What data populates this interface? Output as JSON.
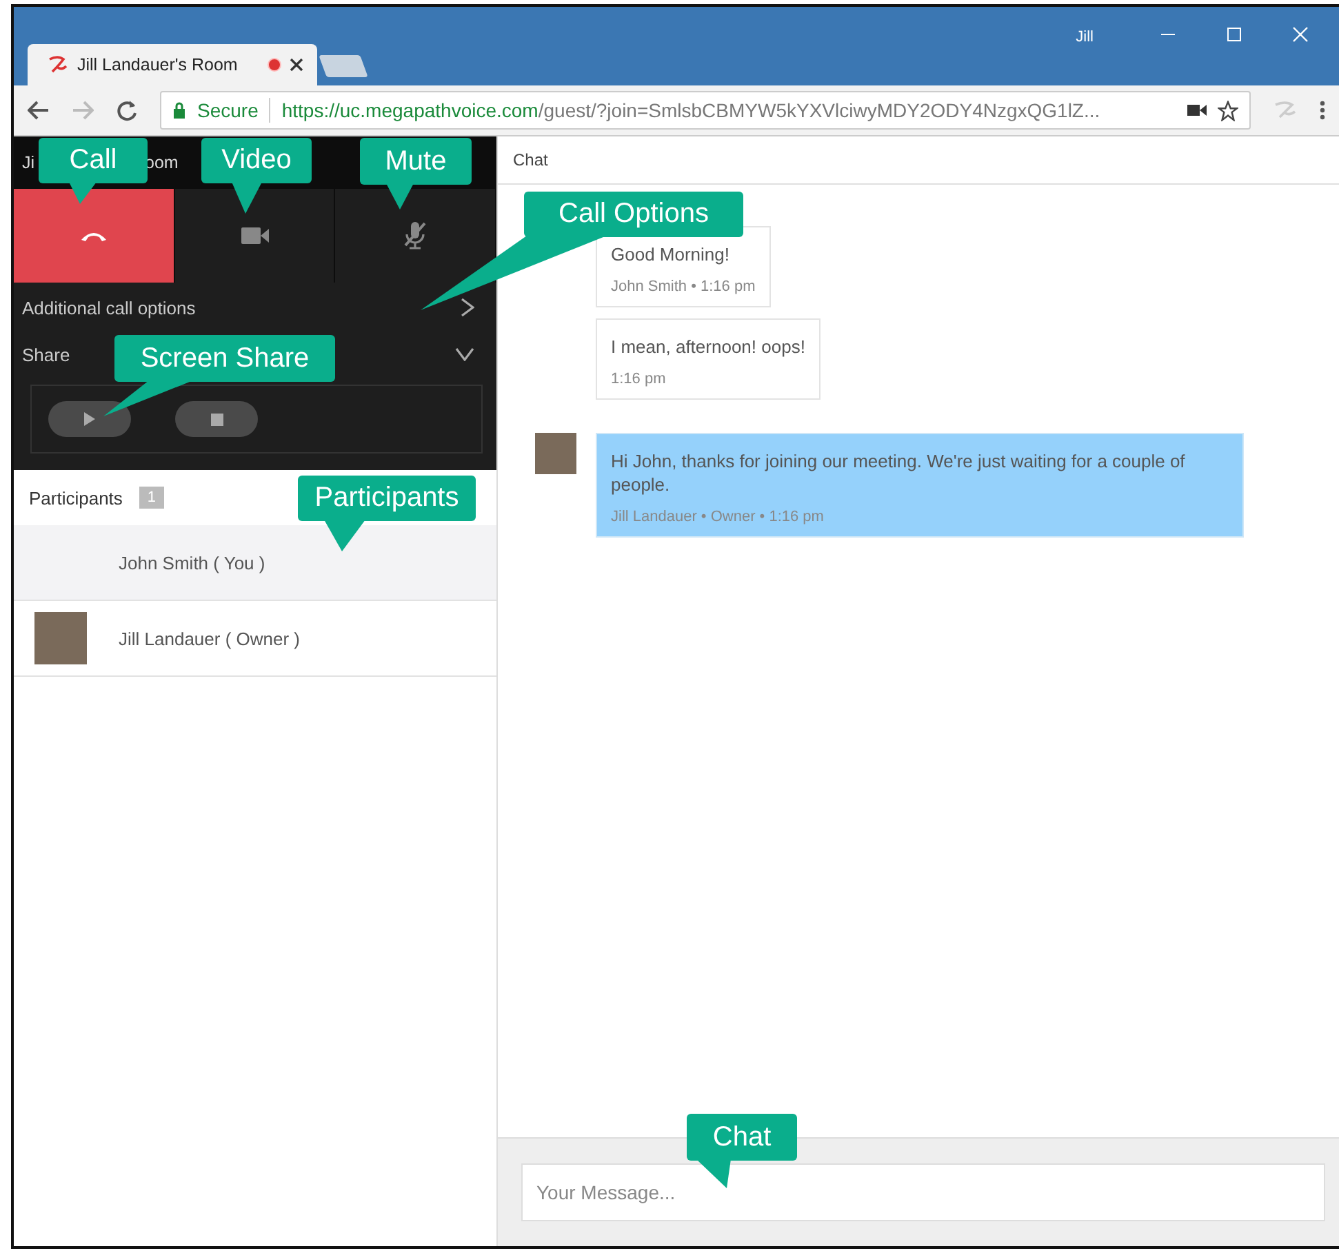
{
  "browser": {
    "tab_title": "Jill Landauer's Room",
    "recording": true,
    "user": "Jill",
    "secure_label": "Secure",
    "url_host": "https://uc.megapathvoice.com",
    "url_path": "/guest/?join=SmlsbCBMYW5kYXVlciwyMDY2ODY4NzgxQG1lZ..."
  },
  "room": {
    "title_parts": [
      "Ji",
      "oom"
    ],
    "controls": [
      {
        "kind": "hangup"
      },
      {
        "kind": "video"
      },
      {
        "kind": "mic"
      }
    ],
    "additional_options": "Additional call options",
    "share": {
      "label": "Share",
      "expanded": true
    },
    "share_controls": [
      {
        "kind": "play"
      },
      {
        "kind": "stop"
      }
    ]
  },
  "participants": {
    "title": "Participants",
    "count": "1",
    "items": [
      {
        "name": "John Smith",
        "role": "( You )",
        "selected": true,
        "avatar": false
      },
      {
        "name": "Jill Landauer",
        "role": "( Owner )",
        "selected": false,
        "avatar": true
      }
    ]
  },
  "chat": {
    "title": "Chat",
    "messages": [
      {
        "text": "Good Morning!",
        "meta": "John Smith • 1:16 pm",
        "highlighted": false,
        "avatar": false
      },
      {
        "text": "I mean, afternoon! oops!",
        "meta": "1:16 pm",
        "highlighted": false,
        "avatar": false
      },
      {
        "text": "Hi John, thanks for joining our meeting. We're just waiting for a couple of people.",
        "meta": "Jill Landauer • Owner • 1:16 pm",
        "highlighted": true,
        "avatar": true
      }
    ],
    "input": {
      "placeholder": "Your Message..."
    }
  },
  "callouts": [
    {
      "kind": "call",
      "label": "Call"
    },
    {
      "kind": "video",
      "label": "Video"
    },
    {
      "kind": "mute",
      "label": "Mute"
    },
    {
      "kind": "call_options",
      "label": "Call Options"
    },
    {
      "kind": "screen_share",
      "label": "Screen Share"
    },
    {
      "kind": "participants",
      "label": "Participants"
    },
    {
      "kind": "chat",
      "label": "Chat"
    }
  ]
}
